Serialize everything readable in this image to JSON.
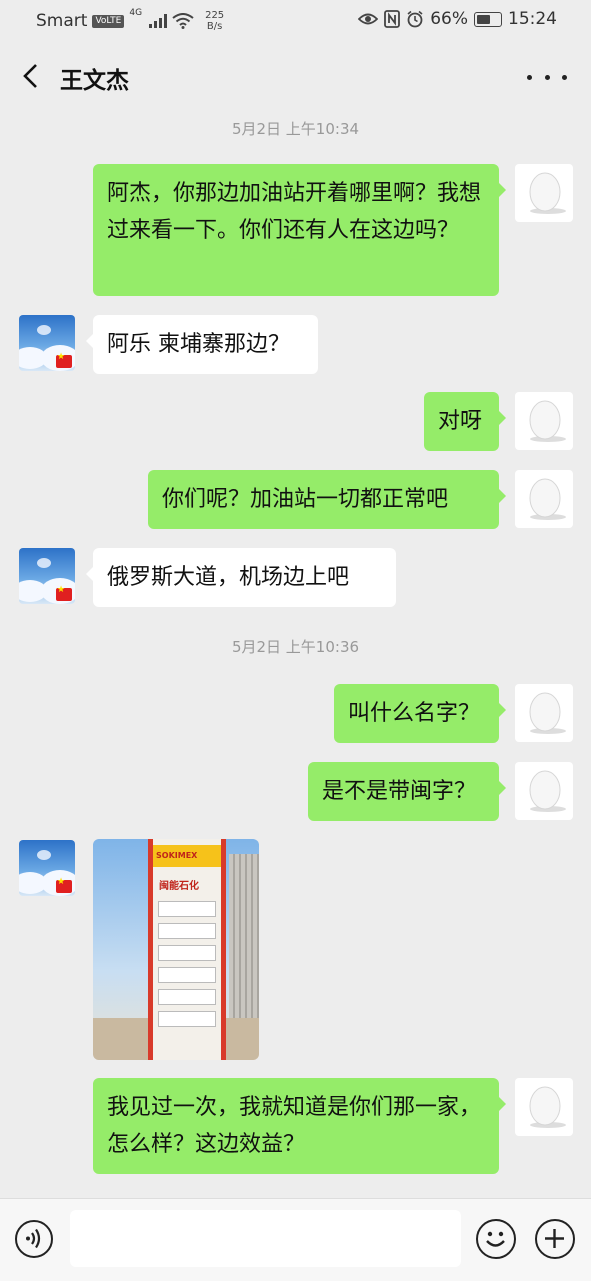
{
  "status_bar": {
    "carrier": "Smart",
    "volte": "VoLTE",
    "network": "4G",
    "speed_value": "225",
    "speed_unit": "B/s",
    "battery": "66%",
    "battery_level": 0.66,
    "time": "15:24"
  },
  "header": {
    "title": "王文杰"
  },
  "messages": [
    {
      "type": "time",
      "text": "5月2日 上午10:34"
    },
    {
      "type": "text",
      "from": "me",
      "text": "阿杰，你那边加油站开着哪里啊？我想过来看一下。你们还有人在这边吗？"
    },
    {
      "type": "text",
      "from": "them",
      "text": "阿乐 柬埔寨那边？"
    },
    {
      "type": "text",
      "from": "me",
      "text": "对呀"
    },
    {
      "type": "text",
      "from": "me",
      "text": "你们呢？加油站一切都正常吧"
    },
    {
      "type": "text",
      "from": "them",
      "text": "俄罗斯大道，机场边上吧"
    },
    {
      "type": "time",
      "text": "5月2日 上午10:36"
    },
    {
      "type": "text",
      "from": "me",
      "text": "叫什么名字？"
    },
    {
      "type": "text",
      "from": "me",
      "text": "是不是带闽字？"
    },
    {
      "type": "image",
      "from": "them",
      "sign_brand": "SOKIMEX",
      "sign_name": "闽能石化"
    },
    {
      "type": "text",
      "from": "me",
      "text": "我见过一次，我就知道是你们那一家，怎么样？这边效益？"
    }
  ],
  "input_bar": {
    "placeholder": ""
  },
  "colors": {
    "my_bubble": "#95ec69",
    "their_bubble": "#ffffff",
    "background": "#ededed"
  }
}
